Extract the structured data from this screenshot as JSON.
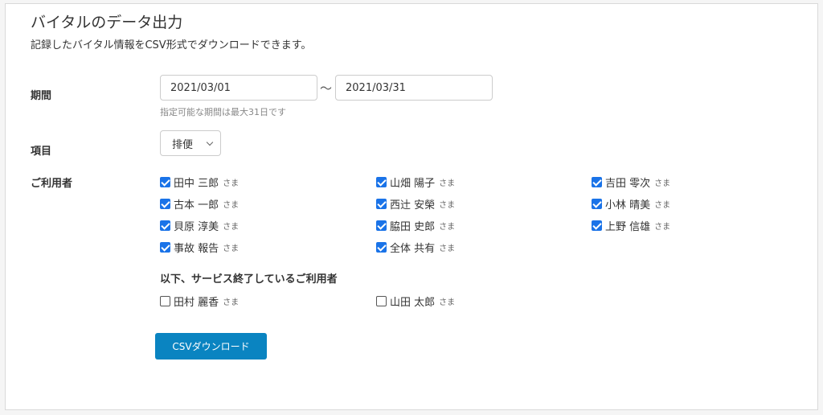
{
  "page": {
    "title": "バイタルのデータ出力",
    "description": "記録したバイタル情報をCSV形式でダウンロードできます。"
  },
  "period": {
    "label": "期間",
    "start": "2021/03/01",
    "separator": "～",
    "end": "2021/03/31",
    "hint": "指定可能な期間は最大31日です"
  },
  "item": {
    "label": "項目",
    "selected": "排便"
  },
  "users": {
    "label": "ご利用者",
    "honorific": "さま",
    "active": [
      {
        "name": "田中 三郎",
        "checked": true
      },
      {
        "name": "山畑 陽子",
        "checked": true
      },
      {
        "name": "吉田 零次",
        "checked": true
      },
      {
        "name": "古本 一郎",
        "checked": true
      },
      {
        "name": "西辻 安榮",
        "checked": true
      },
      {
        "name": "小林 晴美",
        "checked": true
      },
      {
        "name": "貝原 淳美",
        "checked": true
      },
      {
        "name": "脇田 史郎",
        "checked": true
      },
      {
        "name": "上野 信雄",
        "checked": true
      },
      {
        "name": "事故 報告",
        "checked": true
      },
      {
        "name": "全体 共有",
        "checked": true
      }
    ],
    "ended_heading": "以下、サービス終了しているご利用者",
    "ended": [
      {
        "name": "田村 麗香",
        "checked": false
      },
      {
        "name": "山田 太郎",
        "checked": false
      }
    ]
  },
  "actions": {
    "download_label": "CSVダウンロード"
  },
  "colors": {
    "accent": "#0a84c1",
    "checkbox": "#1a73e8"
  }
}
